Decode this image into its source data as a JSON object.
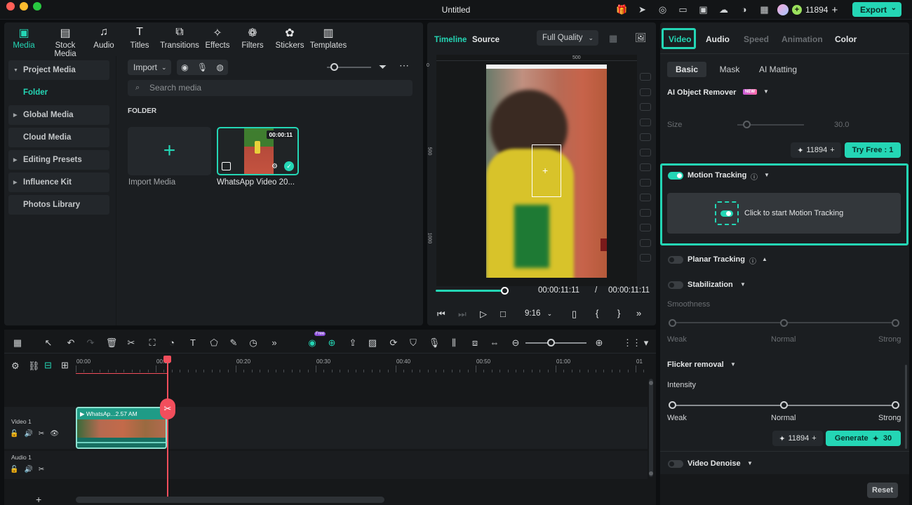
{
  "window": {
    "title": "Untitled"
  },
  "header": {
    "credits": "11894",
    "export_label": "Export"
  },
  "media_tabs": [
    {
      "label": "Media",
      "icon": "media-icon",
      "active": true
    },
    {
      "label": "Stock Media",
      "icon": "stock-media-icon"
    },
    {
      "label": "Audio",
      "icon": "audio-icon"
    },
    {
      "label": "Titles",
      "icon": "titles-icon"
    },
    {
      "label": "Transitions",
      "icon": "transitions-icon"
    },
    {
      "label": "Effects",
      "icon": "effects-icon"
    },
    {
      "label": "Filters",
      "icon": "filters-icon"
    },
    {
      "label": "Stickers",
      "icon": "stickers-icon"
    },
    {
      "label": "Templates",
      "icon": "templates-icon"
    }
  ],
  "sidebar": {
    "items": [
      "Project Media",
      "Folder",
      "Global Media",
      "Cloud Media",
      "Editing Presets",
      "Influence Kit",
      "Photos Library"
    ]
  },
  "media": {
    "import_label": "Import",
    "search_placeholder": "Search media",
    "folder_label": "FOLDER",
    "import_media_label": "Import Media",
    "clip_name": "WhatsApp Video 20...",
    "clip_duration": "00:00:11"
  },
  "preview": {
    "tab_timeline": "Timeline",
    "tab_source": "Source",
    "quality": "Full Quality",
    "ruler_top": "500",
    "ruler_left_0": "0",
    "ruler_left_500": "500",
    "ruler_left_1000": "1000",
    "current_time": "00:00:11:11",
    "total_time": "00:00:11:11",
    "separator": "/",
    "aspect": "9:16",
    "progress": 1.0
  },
  "right": {
    "tabs": [
      "Video",
      "Audio",
      "Speed",
      "Animation",
      "Color"
    ],
    "subtabs": [
      "Basic",
      "Mask",
      "AI Matting"
    ],
    "ai_remover": {
      "label": "AI Object Remover",
      "badge": "NEW",
      "size_label": "Size",
      "size_value": "30.0",
      "credits": "11894",
      "try_label": "Try Free : 1"
    },
    "motion_tracking": {
      "label": "Motion Tracking",
      "cta": "Click to start Motion Tracking"
    },
    "planar_tracking": {
      "label": "Planar Tracking"
    },
    "stabilization": {
      "label": "Stabilization",
      "smoothness": "Smoothness",
      "weak": "Weak",
      "normal": "Normal",
      "strong": "Strong"
    },
    "flicker": {
      "label": "Flicker removal",
      "intensity": "Intensity",
      "weak": "Weak",
      "normal": "Normal",
      "strong": "Strong",
      "credits": "11894",
      "generate_label": "Generate",
      "generate_cost": "30"
    },
    "denoise": {
      "label": "Video Denoise"
    },
    "reset_label": "Reset"
  },
  "timeline": {
    "ruler": [
      "00:00",
      "00:10",
      "00:20",
      "00:30",
      "00:40",
      "00:50",
      "01:00",
      "01"
    ],
    "video_track": "Video 1",
    "audio_track": "Audio 1",
    "clip_label": "WhatsAp...2.57 AM",
    "ai_badge": "Free"
  },
  "colors": {
    "accent": "#24d6b5",
    "playhead": "#f24e5c"
  }
}
